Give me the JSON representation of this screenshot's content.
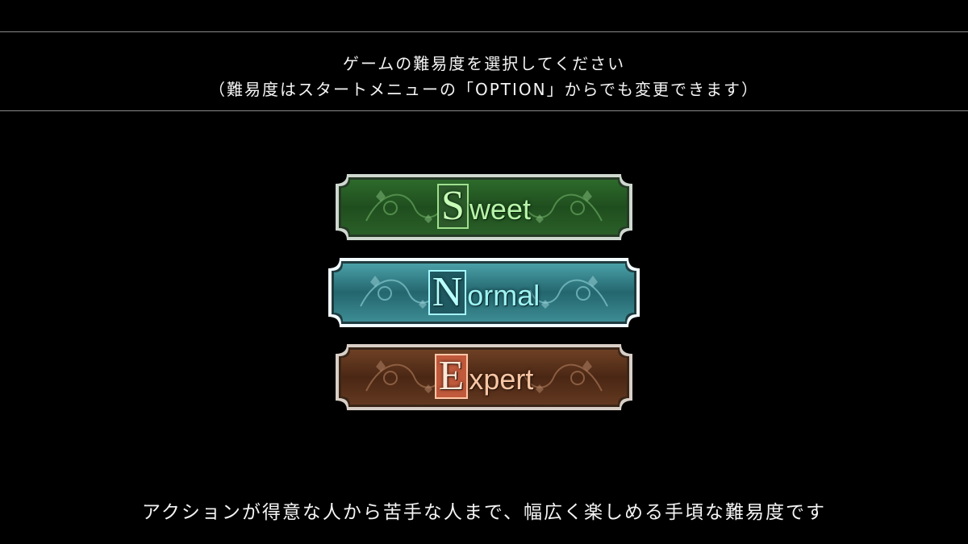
{
  "header": {
    "instruction_line1": "ゲームの難易度を選択してください",
    "instruction_line2": "（難易度はスタートメニューの「OPTION」からでも変更できます）"
  },
  "difficulties": [
    {
      "id": "sweet",
      "initial": "S",
      "rest": "weet",
      "selected": false,
      "theme_color": "#2f6a2c",
      "accent": "#b7f4a9"
    },
    {
      "id": "normal",
      "initial": "N",
      "rest": "ormal",
      "selected": true,
      "theme_color": "#2a6f76",
      "accent": "#9ef3f3"
    },
    {
      "id": "expert",
      "initial": "E",
      "rest": "xpert",
      "selected": false,
      "theme_color": "#6a3a20",
      "accent": "#f7c6a5"
    }
  ],
  "description": "アクションが得意な人から苦手な人まで、幅広く楽しめる手頃な難易度です"
}
